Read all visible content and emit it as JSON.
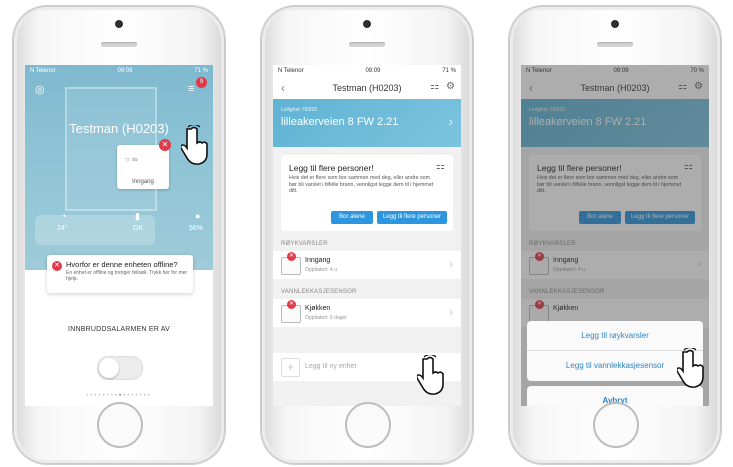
{
  "phone1": {
    "status_time": "09:08",
    "status_left": "N Telenor",
    "status_battery": "71 %",
    "menu_badge": "9",
    "title": "Testman (H0203)",
    "device_label": "Inngang",
    "stat_temp": "24°",
    "stat_ok": "OK",
    "stat_humidity": "56%",
    "offline_title": "Hvorfor er denne enheten offline?",
    "offline_desc": "En enhet er offline og trenger feilsøk. Trykk her for mer hjelp.",
    "alarm_label": "INNBRUDDSALARMEN ER AV"
  },
  "phone2": {
    "status_left": "N Telenor",
    "status_time": "09:09",
    "status_battery": "71 %",
    "title": "Testman (H0203)",
    "banner_small": "Leilighet: H0202",
    "banner_big": "lilleakerveien 8 FW 2.21",
    "invite_title": "Legg til flere personer!",
    "invite_desc": "Hvis det er flere som bor sammen med deg, eller andre som bør bli varslet i tilfelle brann, vennligst legge dem til i hjemmet ditt.",
    "btn_alone": "Bor alene",
    "btn_add": "Legg til flere personer",
    "section1": "RØYKVARSLER",
    "dev1_name": "Inngang",
    "dev1_sub": "Oppdatert: 4 u",
    "section2": "VANNLEKKASJESENSOR",
    "dev2_name": "Kjøkken",
    "dev2_sub": "Oppdatert: 6 dager",
    "add_device": "Legg til ny enhet"
  },
  "phone3": {
    "status_left": "N Telenor",
    "status_time": "09:09",
    "status_battery": "70 %",
    "title": "Testman (H0203)",
    "banner_small": "Leilighet: H0202",
    "banner_big": "lilleakerveien 8 FW 2.21",
    "invite_title": "Legg til flere personer!",
    "invite_desc": "Hvis det er flere som bor sammen med deg, eller andre som bør bli varslet i tilfelle brann, vennligst legge dem til i hjemmet ditt.",
    "btn_alone": "Bor alene",
    "btn_add": "Legg til flere personer",
    "section1": "RØYKVARSLER",
    "dev1_name": "Inngang",
    "dev1_sub": "Oppdatert: 4 u",
    "section2": "VANNLEKKASJESENSOR",
    "dev2_name": "Kjøkken",
    "sheet_smoke": "Legg til røykvarsler",
    "sheet_water": "Legg til vannlekkasjesensor",
    "sheet_cancel": "Avbryt"
  },
  "colors": {
    "accent": "#2c97de",
    "banner": "#6bbad9",
    "alert": "#e03a4a"
  }
}
